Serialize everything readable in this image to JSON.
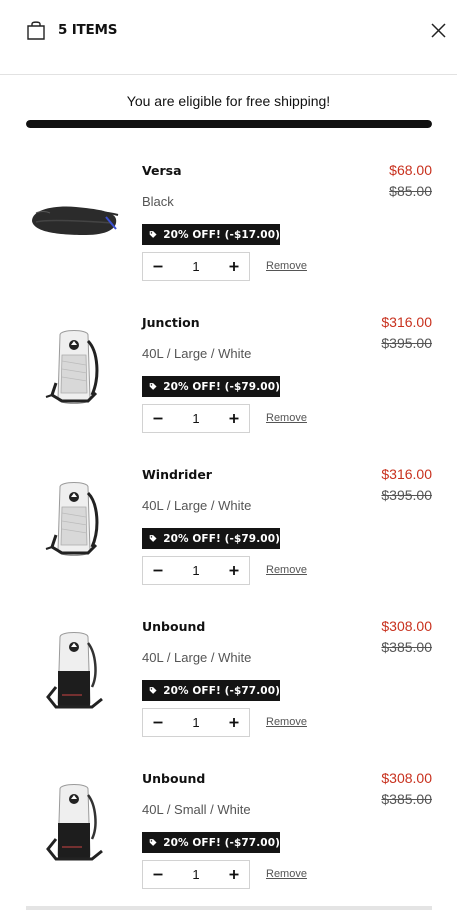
{
  "header": {
    "title": "5 ITEMS",
    "bag_icon": "shopping-bag-icon",
    "close_icon": "close-icon"
  },
  "shipping": {
    "message": "You are eligible for free shipping!",
    "progress": 1.0
  },
  "colors": {
    "sale_price": "#c8311e",
    "badge_bg": "#141414",
    "progress_fill": "#111111"
  },
  "items": [
    {
      "name": "Versa",
      "variant": "Black",
      "price": "$68.00",
      "compare_price": "$85.00",
      "discount": "20% OFF! (-$17.00)",
      "quantity": "1",
      "remove_label": "Remove",
      "image": "black-hip-pack"
    },
    {
      "name": "Junction",
      "variant": "40L / Large / White",
      "price": "$316.00",
      "compare_price": "$395.00",
      "discount": "20% OFF! (-$79.00)",
      "quantity": "1",
      "remove_label": "Remove",
      "image": "white-backpack"
    },
    {
      "name": "Windrider",
      "variant": "40L / Large / White",
      "price": "$316.00",
      "compare_price": "$395.00",
      "discount": "20% OFF! (-$79.00)",
      "quantity": "1",
      "remove_label": "Remove",
      "image": "white-backpack"
    },
    {
      "name": "Unbound",
      "variant": "40L / Large / White",
      "price": "$308.00",
      "compare_price": "$385.00",
      "discount": "20% OFF! (-$77.00)",
      "quantity": "1",
      "remove_label": "Remove",
      "image": "white-black-backpack"
    },
    {
      "name": "Unbound",
      "variant": "40L / Small / White",
      "price": "$308.00",
      "compare_price": "$385.00",
      "discount": "20% OFF! (-$77.00)",
      "quantity": "1",
      "remove_label": "Remove",
      "image": "white-black-backpack"
    }
  ]
}
